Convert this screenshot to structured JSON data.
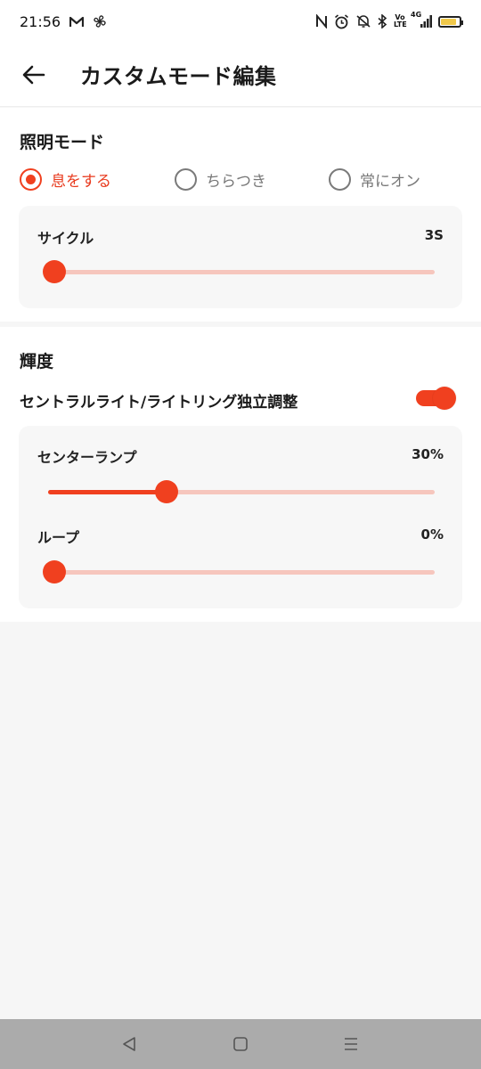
{
  "status_bar": {
    "time": "21:56",
    "network_label": "4G",
    "volte_label": "Vo LTE",
    "battery_level": 0.85,
    "battery_color": "#f0c84a"
  },
  "header": {
    "title": "カスタムモード編集",
    "back_icon": "arrow-left-icon"
  },
  "lighting": {
    "title": "照明モード",
    "modes": [
      {
        "label": "息をする",
        "selected": true
      },
      {
        "label": "ちらつき",
        "selected": false
      },
      {
        "label": "常にオン",
        "selected": false
      }
    ],
    "cycle": {
      "label": "サイクル",
      "value": "3S",
      "level": 0.0
    }
  },
  "brightness": {
    "title": "輝度",
    "independent_toggle": {
      "label": "セントラルライト/ライトリング独立調整",
      "on": true
    },
    "center_lamp": {
      "label": "センターランプ",
      "value": "30%",
      "level": 0.3
    },
    "loop": {
      "label": "ループ",
      "value": "0%",
      "level": 0.0
    }
  },
  "nav": {
    "back_icon": "triangle-back-icon",
    "home_icon": "square-home-icon",
    "menu_icon": "menu-lines-icon"
  },
  "colors": {
    "accent": "#f0401f",
    "accent_light": "#f6c6bd",
    "panel_bg": "#f7f7f7",
    "page_bg": "#f6f6f6"
  }
}
